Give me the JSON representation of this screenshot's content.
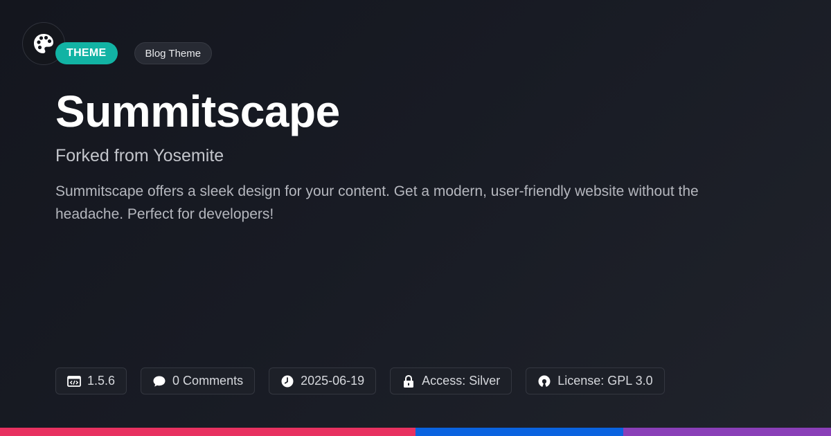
{
  "header": {
    "logo_icon": "palette-icon",
    "category_badge": "THEME",
    "type_badge": "Blog Theme"
  },
  "main": {
    "title": "Summitscape",
    "subtitle": "Forked from Yosemite",
    "description": "Summitscape offers a sleek design for your content. Get a modern, user-friendly website without the headache. Perfect for developers!"
  },
  "meta": [
    {
      "icon": "code-window-icon",
      "text": "1.5.6"
    },
    {
      "icon": "comment-bubble-icon",
      "text": "0 Comments"
    },
    {
      "icon": "clock-icon",
      "text": "2025-06-19"
    },
    {
      "icon": "lock-icon",
      "text": "Access: Silver"
    },
    {
      "icon": "open-source-icon",
      "text": "License: GPL 3.0"
    }
  ],
  "colors": {
    "accent_badge": "#12b3a4",
    "bottom_bar": [
      "#e83160",
      "#0a63e0",
      "#8a3fb8"
    ]
  }
}
